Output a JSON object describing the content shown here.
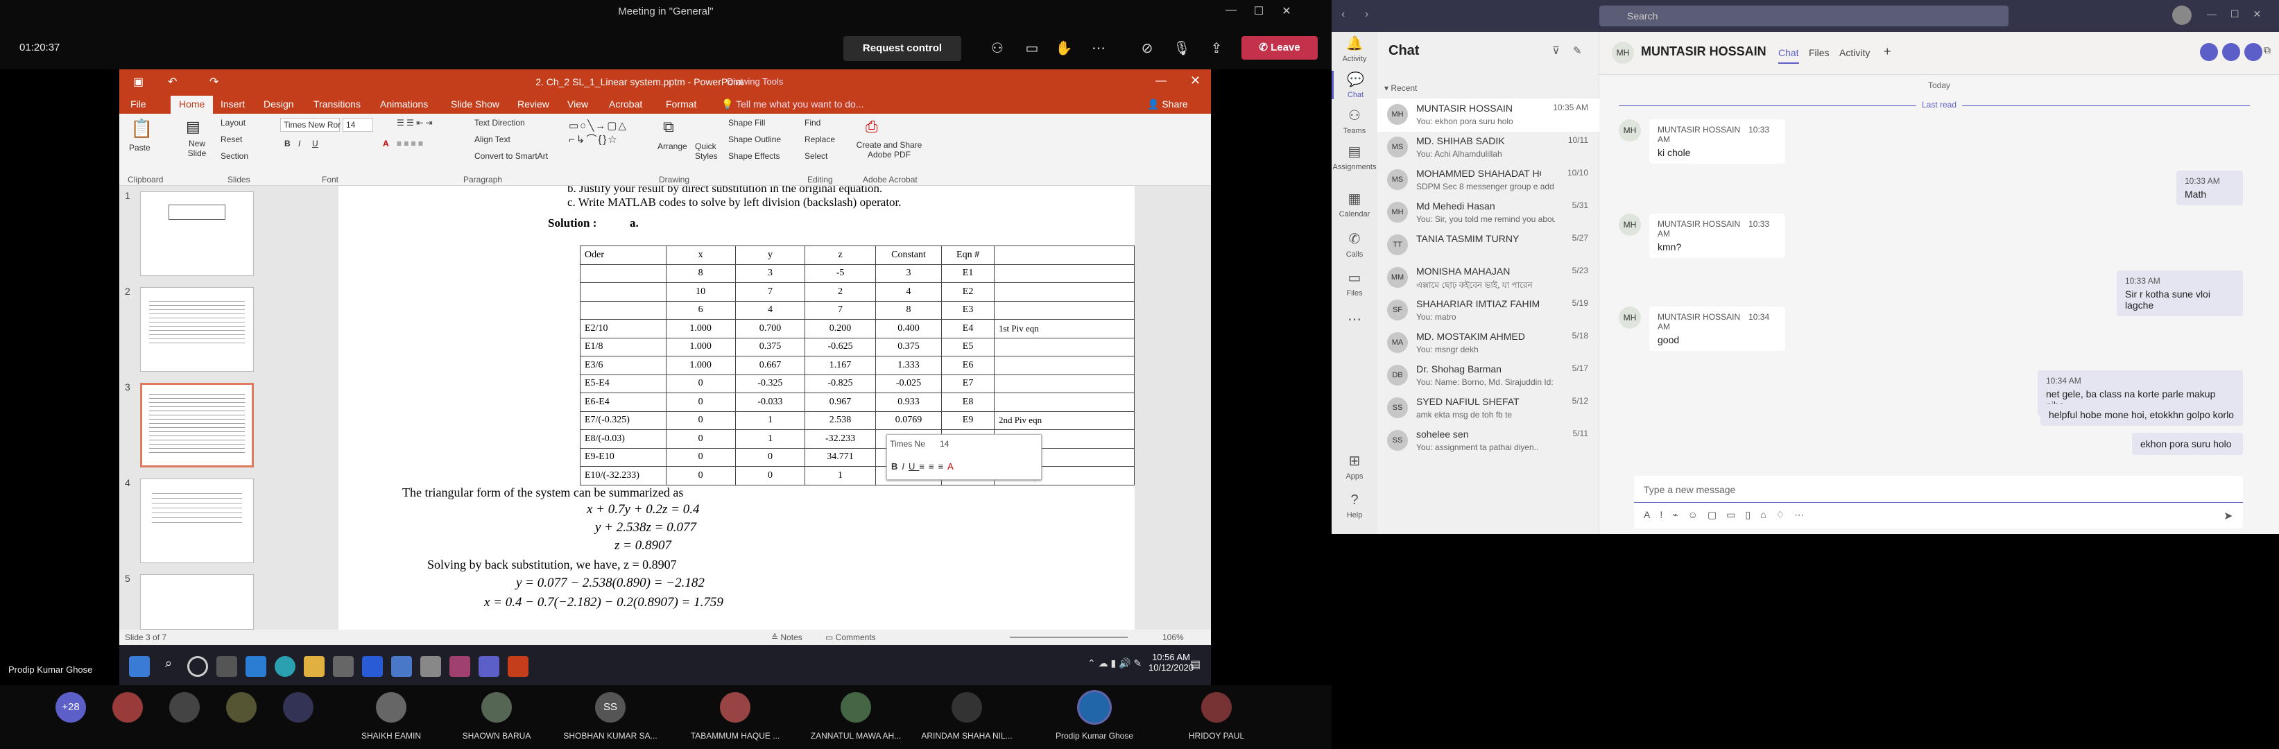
{
  "meeting": {
    "title": "Meeting in \"General\"",
    "timer": "01:20:37",
    "request_control": "Request control",
    "leave": "Leave",
    "presenter": "Prodip Kumar Ghose"
  },
  "ppt": {
    "filename": "2. Ch_2 SL_1_Linear system.pptm - PowerPoint",
    "drawing_tools": "Drawing Tools",
    "tabs": [
      "File",
      "Home",
      "Insert",
      "Design",
      "Transitions",
      "Animations",
      "Slide Show",
      "Review",
      "View",
      "Acrobat",
      "Format"
    ],
    "tell_me": "Tell me what you want to do...",
    "share": "Share",
    "ribbon": {
      "paste": "Paste",
      "new_slide": "New Slide",
      "layout": "Layout",
      "reset": "Reset",
      "section": "Section",
      "font": "Times New Ror",
      "size": "14",
      "text_direction": "Text Direction",
      "align_text": "Align Text",
      "convert": "Convert to SmartArt",
      "arrange": "Arrange",
      "quick_styles": "Quick Styles",
      "shape_fill": "Shape Fill",
      "shape_outline": "Shape Outline",
      "shape_effects": "Shape Effects",
      "find": "Find",
      "replace": "Replace",
      "select": "Select",
      "adobe": "Create and Share Adobe PDF"
    },
    "groups": [
      "Clipboard",
      "Slides",
      "Font",
      "Paragraph",
      "Drawing",
      "Editing",
      "Adobe Acrobat"
    ],
    "status_left": "Slide 3 of 7",
    "notes": "Notes",
    "comments": "Comments",
    "zoom": "106%"
  },
  "slide": {
    "line_b": "b. Justify your result by direct substitution in the original equation.",
    "line_c": "c. Write MATLAB  codes to solve by left division (backslash) operator.",
    "solution": "Solution :",
    "sol_a": "a.",
    "headers": [
      "Oder",
      "x",
      "y",
      "z",
      "Constant",
      "Eqn #",
      ""
    ],
    "rows": [
      [
        "",
        "8",
        "3",
        "-5",
        "3",
        "E1",
        ""
      ],
      [
        "",
        "10",
        "7",
        "2",
        "4",
        "E2",
        ""
      ],
      [
        "",
        "6",
        "4",
        "7",
        "8",
        "E3",
        ""
      ],
      [
        "E2/10",
        "1.000",
        "0.700",
        "0.200",
        "0.400",
        "E4",
        "1st Piv eqn"
      ],
      [
        "E1/8",
        "1.000",
        "0.375",
        "-0.625",
        "0.375",
        "E5",
        ""
      ],
      [
        "E3/6",
        "1.000",
        "0.667",
        "1.167",
        "1.333",
        "E6",
        ""
      ],
      [
        "E5-E4",
        "0",
        "-0.325",
        "-0.825",
        "-0.025",
        "E7",
        ""
      ],
      [
        "E6-E4",
        "0",
        "-0.033",
        "0.967",
        "0.933",
        "E8",
        ""
      ],
      [
        "E7/(-0.325)",
        "0",
        "1",
        "2.538",
        "0.0769",
        "E9",
        "2nd Piv eqn"
      ],
      [
        "E8/(-0.03)",
        "0",
        "1",
        "-32.233",
        "-31.1",
        "E",
        ""
      ],
      [
        "E9-E10",
        "0",
        "0",
        "34.771",
        "31.177",
        "",
        ""
      ],
      [
        "E10/(-32.233)",
        "0",
        "0",
        "1",
        "0.897",
        "",
        "3rd Piv eqn"
      ]
    ],
    "triangular": "The triangular form of the system can be summarized as",
    "eq1": "x + 0.7y + 0.2z = 0.4",
    "eq2": "y + 2.538z = 0.077",
    "eq3": "z = 0.8907",
    "back": "Solving by back substitution,  we have, z = 0.8907",
    "eq4": "y = 0.077 − 2.538(0.890) = −2.182",
    "eq5": "x = 0.4 − 0.7(−2.182) − 0.2(0.8907) = 1.759",
    "mini_font": "Times Ne",
    "mini_size": "14"
  },
  "taskbar": {
    "time": "10:56 AM",
    "date": "10/12/2020"
  },
  "participants": [
    {
      "initials": "+28",
      "name": ""
    },
    {
      "initials": "",
      "name": ""
    },
    {
      "initials": "",
      "name": ""
    },
    {
      "initials": "",
      "name": ""
    },
    {
      "initials": "",
      "name": ""
    },
    {
      "initials": "",
      "name": "SHAIKH EAMIN"
    },
    {
      "initials": "",
      "name": "SHAOWN BARUA"
    },
    {
      "initials": "SS",
      "name": "SHOBHAN KUMAR SA..."
    },
    {
      "initials": "",
      "name": "TABAMMUM HAQUE ..."
    },
    {
      "initials": "",
      "name": "ZANNATUL MAWA AH..."
    },
    {
      "initials": "",
      "name": "ARINDAM SHAHA NIL..."
    },
    {
      "initials": "",
      "name": "Prodip Kumar Ghose"
    },
    {
      "initials": "",
      "name": "HRIDOY PAUL"
    }
  ],
  "teams": {
    "search": "Search",
    "rail": [
      "Activity",
      "Chat",
      "Teams",
      "Assignments",
      "Calendar",
      "Calls",
      "Files",
      "",
      "Apps",
      "Help"
    ],
    "chat_title": "Chat",
    "recent": "Recent",
    "chats": [
      {
        "initials": "MH",
        "name": "MUNTASIR HOSSAIN",
        "preview": "You: ekhon pora suru holo",
        "date": "10:35 AM"
      },
      {
        "initials": "MS",
        "name": "MD. SHIHAB SADIK",
        "preview": "You: Achi Alhamdulillah",
        "date": "10/11"
      },
      {
        "initials": "MS",
        "name": "MOHAMMED SHAHADAT HOS...",
        "preview": "SDPM Sec 8 messenger group e add hot...",
        "date": "10/10"
      },
      {
        "initials": "MH",
        "name": "Md Mehedi Hasan",
        "preview": "You: Sir, you told me remind you about m...",
        "date": "5/31"
      },
      {
        "initials": "TT",
        "name": "TANIA TASMIM TURNY",
        "preview": "",
        "date": "5/27"
      },
      {
        "initials": "MM",
        "name": "MONISHA MAHAJAN",
        "preview": "এক্সামে ছোঢ় কইবেন ভাই, যা পারেন",
        "date": "5/23"
      },
      {
        "initials": "SF",
        "name": "SHAHARIAR IMTIAZ FAHIM",
        "preview": "You: matro",
        "date": "5/19"
      },
      {
        "initials": "MA",
        "name": "MD. MOSTAKIM AHMED",
        "preview": "You: msngr dekh",
        "date": "5/18"
      },
      {
        "initials": "DB",
        "name": "Dr. Shohag Barman",
        "preview": "You: Name: Borno, Md. Sirajuddin Id: 18-3...",
        "date": "5/17"
      },
      {
        "initials": "SS",
        "name": "SYED NAFIUL SHEFAT",
        "preview": "amk ekta msg de toh fb te",
        "date": "5/12"
      },
      {
        "initials": "SS",
        "name": "sohelee sen",
        "preview": "You: assignment ta pathai diyen..",
        "date": "5/11"
      }
    ],
    "contact": "MUNTASIR HOSSAIN",
    "tabs": [
      "Chat",
      "Files",
      "Activity"
    ],
    "today": "Today",
    "last_read": "Last read",
    "messages": [
      {
        "who": "MUNTASIR HOSSAIN",
        "time": "10:33 AM",
        "text": "ki chole"
      },
      {
        "who": "MUNTASIR HOSSAIN",
        "time": "10:33 AM",
        "text": "kmn?"
      },
      {
        "who": "MUNTASIR HOSSAIN",
        "time": "10:34 AM",
        "text": "good"
      }
    ],
    "mine": [
      {
        "time": "10:33 AM",
        "text": "Math"
      },
      {
        "time": "10:33 AM",
        "text": "Sir r kotha sune vloi lagche"
      },
      {
        "time": "10:34 AM",
        "text": "net gele, ba class na korte parle makup nibe"
      },
      {
        "time": "",
        "text": "helpful hobe mone hoi, etokkhn golpo korlo"
      },
      {
        "time": "",
        "text": "ekhon pora suru holo"
      }
    ],
    "composer": "Type a new message"
  }
}
